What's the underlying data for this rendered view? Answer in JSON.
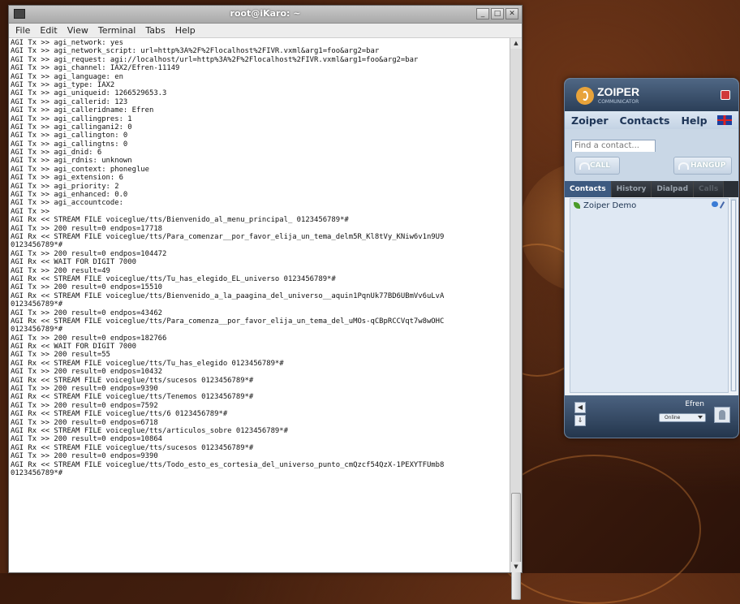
{
  "terminal": {
    "title": "root@iKaro: ~",
    "menu": [
      "File",
      "Edit",
      "View",
      "Terminal",
      "Tabs",
      "Help"
    ],
    "lines": [
      "AGI Tx >> agi_network: yes",
      "AGI Tx >> agi_network_script: url=http%3A%2F%2Flocalhost%2FIVR.vxml&arg1=foo&arg2=bar",
      "AGI Tx >> agi_request: agi://localhost/url=http%3A%2F%2Flocalhost%2FIVR.vxml&arg1=foo&arg2=bar",
      "AGI Tx >> agi_channel: IAX2/Efren-11149",
      "AGI Tx >> agi_language: en",
      "AGI Tx >> agi_type: IAX2",
      "AGI Tx >> agi_uniqueid: 1266529653.3",
      "AGI Tx >> agi_callerid: 123",
      "AGI Tx >> agi_calleridname: Efren",
      "AGI Tx >> agi_callingpres: 1",
      "AGI Tx >> agi_callingani2: 0",
      "AGI Tx >> agi_callington: 0",
      "AGI Tx >> agi_callingtns: 0",
      "AGI Tx >> agi_dnid: 6",
      "AGI Tx >> agi_rdnis: unknown",
      "AGI Tx >> agi_context: phoneglue",
      "AGI Tx >> agi_extension: 6",
      "AGI Tx >> agi_priority: 2",
      "AGI Tx >> agi_enhanced: 0.0",
      "AGI Tx >> agi_accountcode:",
      "AGI Tx >>",
      "AGI Rx << STREAM FILE voiceglue/tts/Bienvenido_al_menu_principal_ 0123456789*#",
      "AGI Tx >> 200 result=0 endpos=17718",
      "AGI Rx << STREAM FILE voiceglue/tts/Para_comenzar__por_favor_elija_un_tema_delm5R_Kl8tVy_KNiw6v1n9U9",
      "0123456789*#",
      "AGI Tx >> 200 result=0 endpos=104472",
      "AGI Rx << WAIT FOR DIGIT 7000",
      "AGI Tx >> 200 result=49",
      "AGI Rx << STREAM FILE voiceglue/tts/Tu_has_elegido_EL_universo 0123456789*#",
      "AGI Tx >> 200 result=0 endpos=15510",
      "AGI Rx << STREAM FILE voiceglue/tts/Bienvenido_a_la_paagina_del_universo__aquin1PqnUk77BD6UBmVv6uLvA",
      "0123456789*#",
      "AGI Tx >> 200 result=0 endpos=43462",
      "AGI Rx << STREAM FILE voiceglue/tts/Para_comenza__por_favor_elija_un_tema_del_uMOs-qCBpRCCVqt7w8wOHC",
      "0123456789*#",
      "AGI Tx >> 200 result=0 endpos=182766",
      "AGI Rx << WAIT FOR DIGIT 7000",
      "AGI Tx >> 200 result=55",
      "AGI Rx << STREAM FILE voiceglue/tts/Tu_has_elegido 0123456789*#",
      "AGI Tx >> 200 result=0 endpos=10432",
      "AGI Rx << STREAM FILE voiceglue/tts/sucesos 0123456789*#",
      "AGI Tx >> 200 result=0 endpos=9390",
      "AGI Rx << STREAM FILE voiceglue/tts/Tenemos 0123456789*#",
      "AGI Tx >> 200 result=0 endpos=7592",
      "AGI Rx << STREAM FILE voiceglue/tts/6 0123456789*#",
      "AGI Tx >> 200 result=0 endpos=6718",
      "AGI Rx << STREAM FILE voiceglue/tts/articulos_sobre 0123456789*#",
      "AGI Tx >> 200 result=0 endpos=10864",
      "AGI Rx << STREAM FILE voiceglue/tts/sucesos 0123456789*#",
      "AGI Tx >> 200 result=0 endpos=9390",
      "AGI Rx << STREAM FILE voiceglue/tts/Todo_esto_es_cortesia_del_universo_punto_cmQzcf54QzX-1PEXYTFUmb8",
      "0123456789*#"
    ]
  },
  "zoiper": {
    "brand": "ZOIPER",
    "subtitle": "COMMUNICATOR",
    "menu": [
      "Zoiper",
      "Contacts",
      "Help"
    ],
    "search_placeholder": "Find a contact...",
    "call_label": "CALL",
    "hangup_label": "HANGUP",
    "tabs": [
      "Contacts",
      "History",
      "Dialpad",
      "Calls"
    ],
    "active_tab": 0,
    "contacts": [
      {
        "name": "Zoiper Demo"
      }
    ],
    "user_name": "Efren",
    "status": "Online"
  }
}
